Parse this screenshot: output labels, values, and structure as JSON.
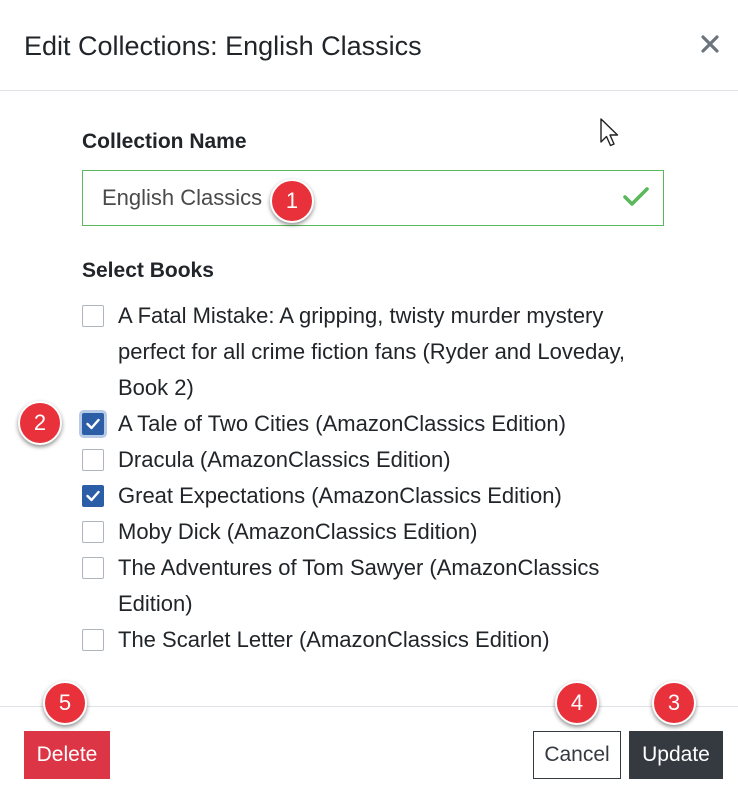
{
  "modal": {
    "title": "Edit Collections: English Classics",
    "close_icon": "close-icon",
    "close_glyph": "×"
  },
  "form": {
    "name_label": "Collection Name",
    "name_value": "English Classics",
    "name_valid": true,
    "books_label": "Select Books"
  },
  "books": [
    {
      "title": "A Fatal Mistake: A gripping, twisty murder mystery perfect for all crime fiction fans (Ryder and Loveday, Book 2)",
      "checked": false
    },
    {
      "title": "A Tale of Two Cities (AmazonClassics Edition)",
      "checked": true,
      "focused": true
    },
    {
      "title": "Dracula (AmazonClassics Edition)",
      "checked": false
    },
    {
      "title": "Great Expectations (AmazonClassics Edition)",
      "checked": true
    },
    {
      "title": "Moby Dick (AmazonClassics Edition)",
      "checked": false
    },
    {
      "title": "The Adventures of Tom Sawyer (AmazonClassics Edition)",
      "checked": false
    },
    {
      "title": "The Scarlet Letter (AmazonClassics Edition)",
      "checked": false
    }
  ],
  "footer": {
    "delete_label": "Delete",
    "cancel_label": "Cancel",
    "update_label": "Update"
  },
  "callouts": {
    "name_input": "1",
    "checkbox": "2",
    "update": "3",
    "cancel": "4",
    "delete": "5"
  },
  "colors": {
    "valid_border": "#5cb85c",
    "checkbox_checked": "#2c5ea8",
    "delete_button": "#dc3545",
    "update_button": "#343a40",
    "callout": "#e8313a"
  }
}
